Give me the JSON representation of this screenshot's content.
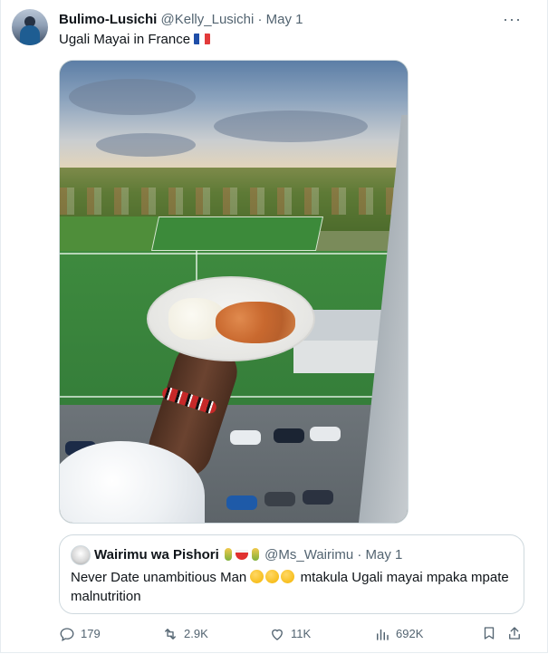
{
  "tweet": {
    "author_name": "Bulimo-Lusichi",
    "handle": "@Kelly_Lusichi",
    "separator": "·",
    "date": "May 1",
    "text": "Ugali Mayai in France",
    "flag_icon": "france-flag-icon",
    "more_icon": "more-horizontal-icon",
    "more_label": "···"
  },
  "quoted_tweet": {
    "author_name": "Wairimu wa Pishori",
    "name_emojis": [
      "corn-emoji",
      "rice-bowl-emoji",
      "corn-emoji"
    ],
    "handle": "@Ms_Wairimu",
    "separator": "·",
    "date": "May 1",
    "text_before": "Never Date unambitious Man",
    "emojis": [
      "face-exhaling-emoji",
      "face-exhaling-emoji",
      "face-exhaling-emoji"
    ],
    "text_after": "mtakula Ugali mayai mpaka mpate malnutrition"
  },
  "actions": {
    "replies": "179",
    "retweets": "2.9K",
    "likes": "11K",
    "views": "692K"
  },
  "colors": {
    "text_primary": "#0f1419",
    "text_muted": "#536471",
    "border": "#cfd9de"
  }
}
